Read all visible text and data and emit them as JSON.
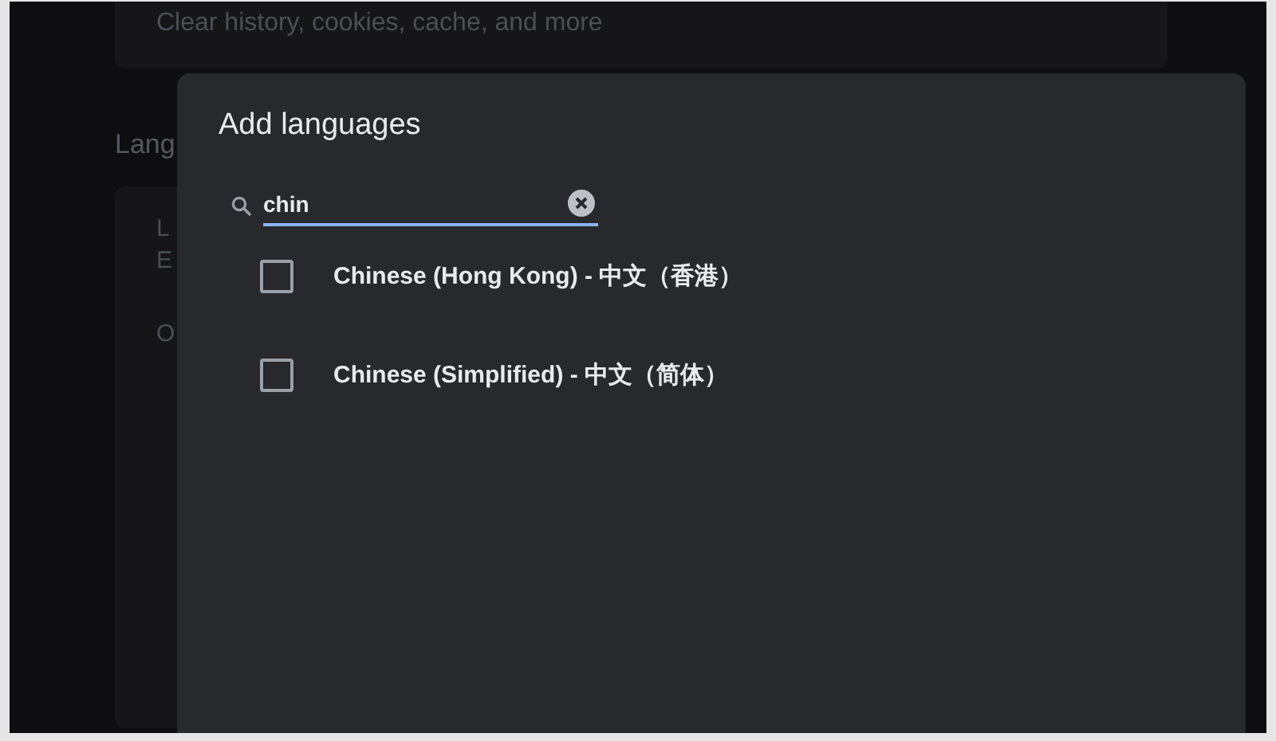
{
  "background": {
    "card_text": "Clear history, cookies, cache, and more",
    "section_heading": "Lang",
    "card_lines": [
      "L",
      "E",
      "O"
    ]
  },
  "dialog": {
    "title": "Add languages",
    "search": {
      "value": "chin"
    },
    "options": [
      {
        "label": "Chinese (Hong Kong) - 中文（香港）",
        "checked": false
      },
      {
        "label": "Chinese (Simplified) - 中文（简体）",
        "checked": false
      }
    ]
  }
}
